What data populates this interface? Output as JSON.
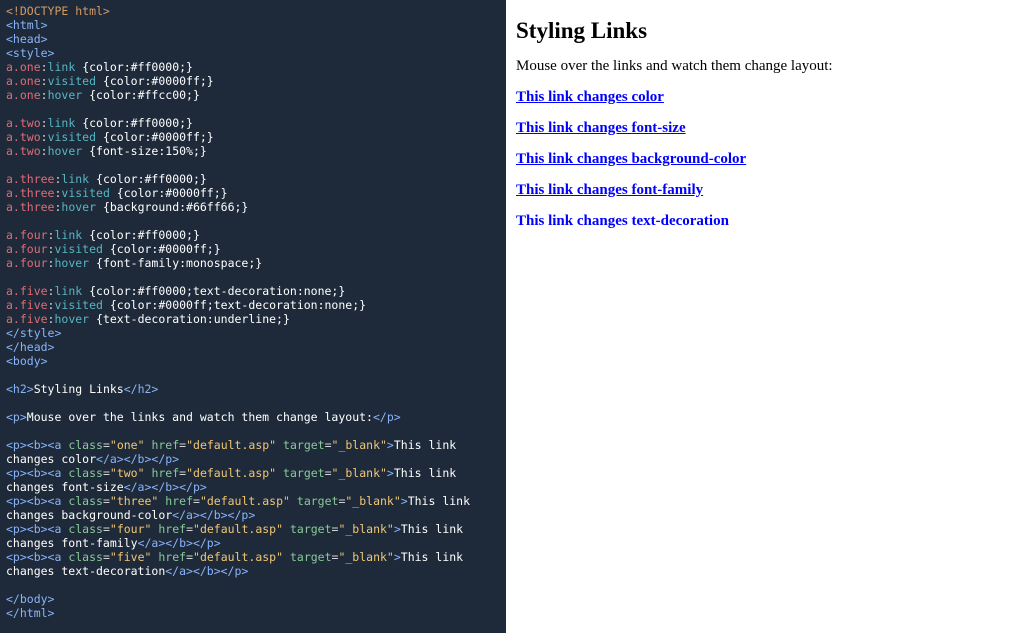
{
  "code": {
    "l01": "<!DOCTYPE html>",
    "l02": "<html>",
    "l03": "<head>",
    "l04": "<style>",
    "sel1": "a.one",
    "ps_link": "link",
    "rule1": " {color:#ff0000;}",
    "sel1b": "a.one",
    "ps_vis": "visited",
    "rule1b": " {color:#0000ff;}",
    "sel1c": "a.one",
    "ps_hov": "hover",
    "rule1c": " {color:#ffcc00;}",
    "sel2": "a.two",
    "rule2a": " {color:#ff0000;}",
    "rule2b": " {color:#0000ff;}",
    "rule2c": " {font-size:150%;}",
    "sel3": "a.three",
    "rule3a": " {color:#ff0000;}",
    "rule3b": " {color:#0000ff;}",
    "rule3c": " {background:#66ff66;}",
    "sel4": "a.four",
    "rule4a": " {color:#ff0000;}",
    "rule4b": " {color:#0000ff;}",
    "rule4c": " {font-family:monospace;}",
    "sel5": "a.five",
    "rule5a": " {color:#ff0000;text-decoration:none;}",
    "rule5b": " {color:#0000ff;text-decoration:none;}",
    "rule5c": " {text-decoration:underline;}",
    "l_style_end": "</style>",
    "l_head_end": "</head>",
    "l_body": "<body>",
    "h2_open": "<h2>",
    "h2_txt": "Styling Links",
    "h2_close": "</h2>",
    "p_open": "<p>",
    "p_txt": "Mouse over the links and watch them change layout:",
    "p_close": "</p>",
    "class_attr": "class",
    "href_attr": "href",
    "target_attr": "target",
    "class_one": "\"one\"",
    "class_two": "\"two\"",
    "class_three": "\"three\"",
    "class_four": "\"four\"",
    "class_five": "\"five\"",
    "href_val": "\"default.asp\"",
    "target_val": "\"_blank\"",
    "link1_txt_a": "This link",
    "link1_txt_b": "changes color",
    "link2_txt_a": "This link",
    "link2_txt_b": "changes font-size",
    "link3_txt_a": "This link",
    "link3_txt_b": "changes background-color",
    "link4_txt_a": "This link",
    "link4_txt_b": "changes font-family",
    "link5_txt_a": "This link",
    "link5_txt_b": "changes text-decoration",
    "pba_open": "<p><b><a",
    "a_close": "</a></b></p>",
    "l_body_end": "</body>",
    "l_html_end": "</html>"
  },
  "preview": {
    "heading": "Styling Links",
    "intro": "Mouse over the links and watch them change layout:",
    "links": {
      "one": "This link changes color",
      "two": "This link changes font-size",
      "three": "This link changes background-color",
      "four": "This link changes font-family",
      "five": "This link changes text-decoration"
    }
  }
}
